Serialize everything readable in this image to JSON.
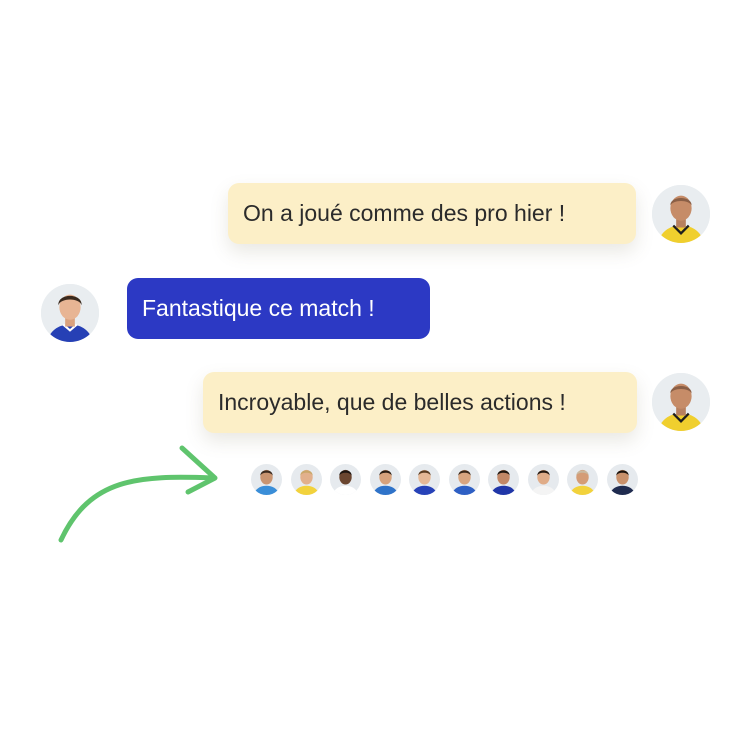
{
  "messages": [
    {
      "text": "On a joué comme des pro hier !",
      "style": "yellow",
      "side": "right",
      "avatar": "player-yellow-jersey"
    },
    {
      "text": "Fantastique ce match !",
      "style": "blue",
      "side": "left",
      "avatar": "player-blue-jersey"
    },
    {
      "text": "Incroyable, que de belles actions !",
      "style": "yellow",
      "side": "right",
      "avatar": "player-yellow-jersey"
    }
  ],
  "reactions": {
    "avatars": [
      {
        "jersey": "#3a8ed8",
        "skin": "#c99470",
        "hair": "#3b2a1e"
      },
      {
        "jersey": "#f2d23c",
        "skin": "#e2b08c",
        "hair": "#caa76a"
      },
      {
        "jersey": "#ffffff",
        "skin": "#6b4630",
        "hair": "#1e1510"
      },
      {
        "jersey": "#2f73c9",
        "skin": "#d7a27c",
        "hair": "#2c1e14"
      },
      {
        "jersey": "#2742b8",
        "skin": "#e6b896",
        "hair": "#5a3c22"
      },
      {
        "jersey": "#2e5fc4",
        "skin": "#d9a57f",
        "hair": "#3a2718"
      },
      {
        "jersey": "#2036a8",
        "skin": "#c28766",
        "hair": "#1f1610"
      },
      {
        "jersey": "#f4f4f4",
        "skin": "#e0ac88",
        "hair": "#241810"
      },
      {
        "jersey": "#f2d23c",
        "skin": "#d49c76",
        "hair": "#c9b9a0"
      },
      {
        "jersey": "#1f2b4f",
        "skin": "#c9916b",
        "hair": "#1b130d"
      }
    ]
  },
  "colors": {
    "yellow_bubble": "#fcefc7",
    "blue_bubble": "#2c39c4",
    "arrow": "#5fc46d"
  },
  "icons": {
    "arrow": "curved-arrow-icon"
  }
}
